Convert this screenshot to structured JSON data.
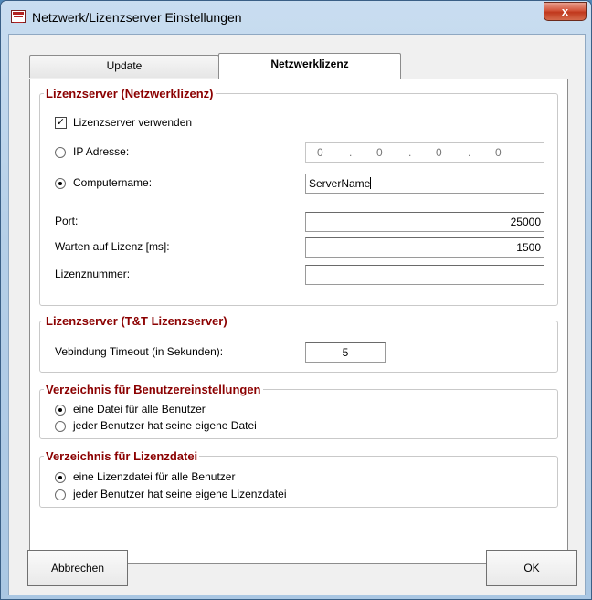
{
  "window": {
    "title": "Netzwerk/Lizenzserver Einstellungen",
    "close_label": "x"
  },
  "tabs": [
    {
      "label": "Update",
      "selected": false
    },
    {
      "label": "Netzwerklizenz",
      "selected": true
    }
  ],
  "group_license_server": {
    "legend": "Lizenzserver (Netzwerklizenz)",
    "use_server": {
      "label": "Lizenzserver verwenden",
      "checked": true,
      "mark": "✓"
    },
    "ip": {
      "label": "IP Adresse:",
      "selected": false,
      "octets": [
        "0",
        "0",
        "0",
        "0"
      ]
    },
    "computer": {
      "label": "Computername:",
      "selected": true,
      "value": "ServerName"
    },
    "port": {
      "label": "Port:",
      "value": "25000"
    },
    "wait": {
      "label": "Warten auf Lizenz [ms]:",
      "value": "1500"
    },
    "license_number": {
      "label": "Lizenznummer:",
      "value": ""
    }
  },
  "group_tt_server": {
    "legend": "Lizenzserver (T&T Lizenzserver)",
    "timeout": {
      "label": "Vebindung Timeout (in Sekunden):",
      "value": "5"
    }
  },
  "group_user_settings": {
    "legend": "Verzeichnis für Benutzereinstellungen",
    "options": [
      {
        "label": "eine Datei für alle Benutzer",
        "selected": true
      },
      {
        "label": "jeder Benutzer hat seine eigene Datei",
        "selected": false
      }
    ]
  },
  "group_license_file": {
    "legend": "Verzeichnis für Lizenzdatei",
    "options": [
      {
        "label": "eine Lizenzdatei für alle Benutzer",
        "selected": true
      },
      {
        "label": "jeder Benutzer hat seine eigene Lizenzdatei",
        "selected": false
      }
    ]
  },
  "buttons": {
    "cancel": "Abbrechen",
    "ok": "OK"
  },
  "colors": {
    "accent": "#8b0000",
    "titlebar": "#b5cfe8",
    "close": "#c0381c"
  }
}
